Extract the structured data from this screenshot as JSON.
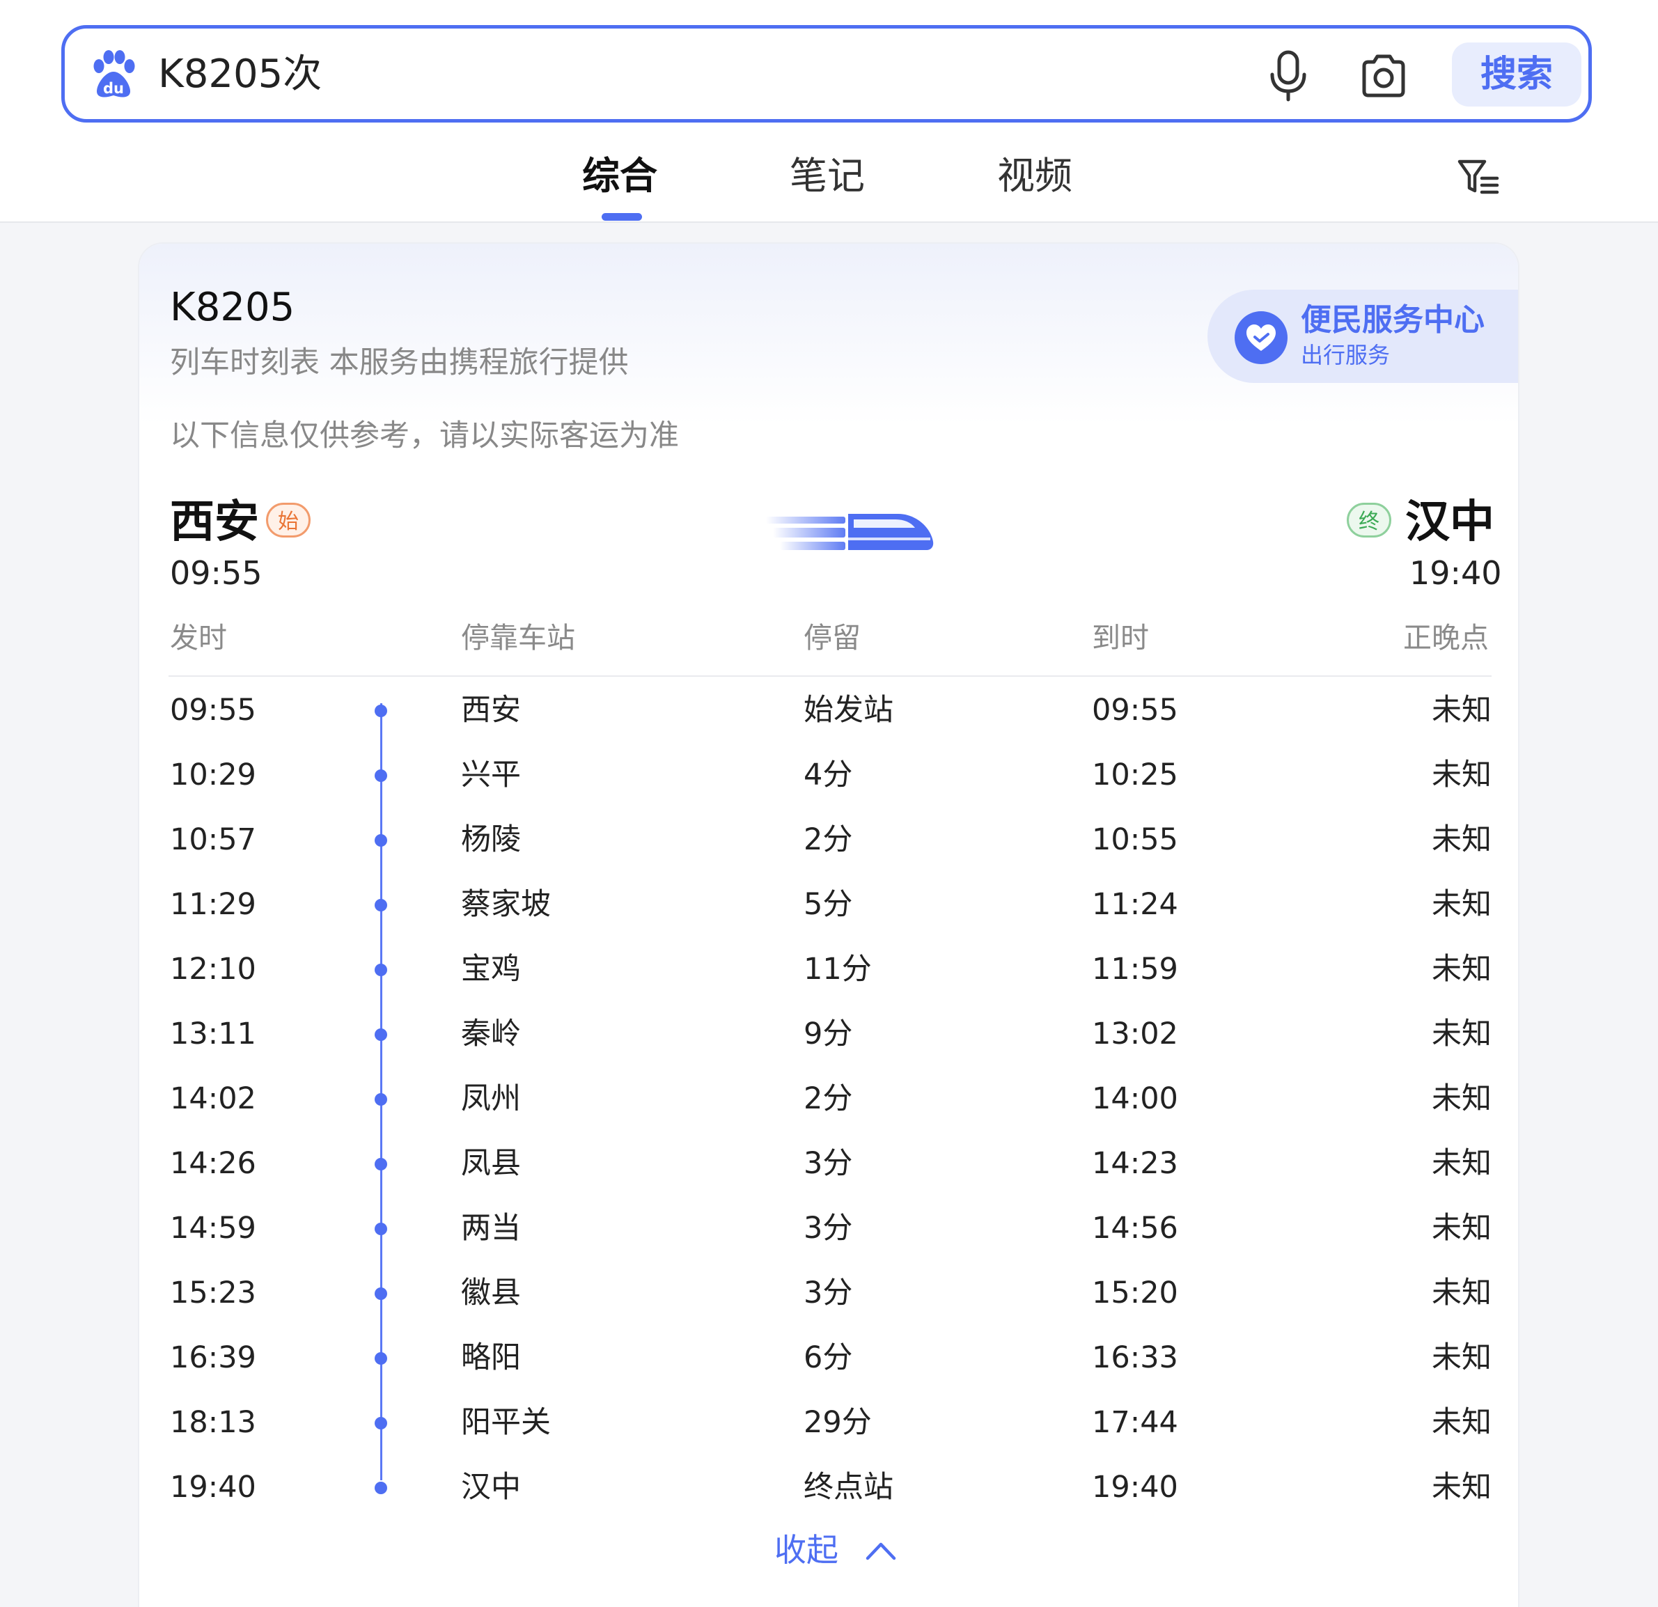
{
  "search": {
    "query": "K8205次",
    "button_label": "搜索"
  },
  "tabs": [
    {
      "label": "综合"
    },
    {
      "label": "笔记"
    },
    {
      "label": "视频"
    }
  ],
  "card": {
    "train_number": "K8205",
    "subtitle": "列车时刻表 本服务由携程旅行提供",
    "notice": "以下信息仅供参考，请以实际客运为准",
    "service": {
      "title": "便民服务中心",
      "subtitle": "出行服务"
    },
    "origin": {
      "city": "西安",
      "badge": "始",
      "time": "09:55"
    },
    "destination": {
      "city": "汉中",
      "badge": "终",
      "time": "19:40"
    },
    "columns": [
      "发时",
      "停靠车站",
      "停留",
      "到时",
      "正晚点"
    ],
    "stops": [
      {
        "depart": "09:55",
        "station": "西安",
        "stay": "始发站",
        "arrive": "09:55",
        "status": "未知"
      },
      {
        "depart": "10:29",
        "station": "兴平",
        "stay": "4分",
        "arrive": "10:25",
        "status": "未知"
      },
      {
        "depart": "10:57",
        "station": "杨陵",
        "stay": "2分",
        "arrive": "10:55",
        "status": "未知"
      },
      {
        "depart": "11:29",
        "station": "蔡家坡",
        "stay": "5分",
        "arrive": "11:24",
        "status": "未知"
      },
      {
        "depart": "12:10",
        "station": "宝鸡",
        "stay": "11分",
        "arrive": "11:59",
        "status": "未知"
      },
      {
        "depart": "13:11",
        "station": "秦岭",
        "stay": "9分",
        "arrive": "13:02",
        "status": "未知"
      },
      {
        "depart": "14:02",
        "station": "凤州",
        "stay": "2分",
        "arrive": "14:00",
        "status": "未知"
      },
      {
        "depart": "14:26",
        "station": "凤县",
        "stay": "3分",
        "arrive": "14:23",
        "status": "未知"
      },
      {
        "depart": "14:59",
        "station": "两当",
        "stay": "3分",
        "arrive": "14:56",
        "status": "未知"
      },
      {
        "depart": "15:23",
        "station": "徽县",
        "stay": "3分",
        "arrive": "15:20",
        "status": "未知"
      },
      {
        "depart": "16:39",
        "station": "略阳",
        "stay": "6分",
        "arrive": "16:33",
        "status": "未知"
      },
      {
        "depart": "18:13",
        "station": "阳平关",
        "stay": "29分",
        "arrive": "17:44",
        "status": "未知"
      },
      {
        "depart": "19:40",
        "station": "汉中",
        "stay": "终点站",
        "arrive": "19:40",
        "status": "未知"
      }
    ],
    "collapse_label": "收起"
  },
  "icons": {
    "logo": "baidu-paw-icon",
    "voice": "microphone-icon",
    "camera": "camera-icon",
    "filter": "filter-icon",
    "service": "heart-hands-icon",
    "train": "high-speed-train-icon",
    "collapse": "chevron-up-icon"
  },
  "colors": {
    "accent": "#4e6ef2",
    "origin_badge": "#e97434",
    "destination_badge": "#3caa55",
    "muted_text": "#888888"
  }
}
